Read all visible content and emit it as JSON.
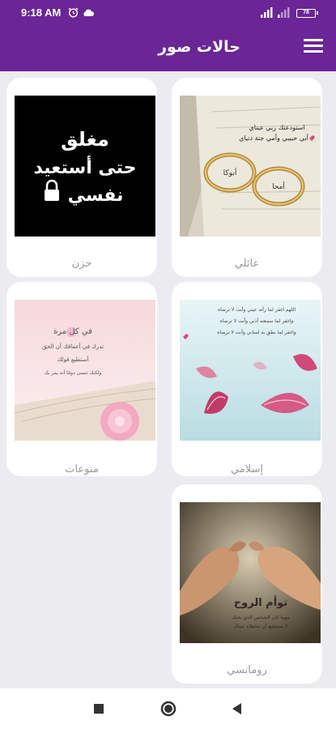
{
  "status_bar": {
    "time": "9:18 AM",
    "battery": "78",
    "icons": [
      "alarm-icon",
      "cloud-icon",
      "signal-icon",
      "signal-weak-icon",
      "battery-icon"
    ]
  },
  "app_bar": {
    "title": "حالات صور",
    "menu_icon": "hamburger-menu-icon",
    "color": "#6a2596"
  },
  "categories": [
    {
      "label": "عائلي",
      "image_text": [
        "استودعتك ربي عيناي",
        "أبي حبيبي وأمي جنة دنياي",
        "أبوكا",
        "أمحا"
      ]
    },
    {
      "label": "حزن",
      "image_text": [
        "مغلق",
        "حتى أستعيد",
        "نفسي"
      ]
    },
    {
      "label": "إسلامي",
      "image_text": [
        "اللهم اغفر لما رأته عيني وأنت لا ترضاه",
        "واغفر لما سمعته أذني وأنت لا ترضاه",
        "واغفر لما نطق به لساني وأنت لا ترضاه"
      ]
    },
    {
      "label": "منوعات",
      "image_text": [
        "في كل مرة",
        "تدرك في أعماقك أن الحق",
        "أستطيع قولك",
        "ولكنك تنسى دومًا أنه يمر بك"
      ]
    },
    {
      "label": "رومانسي",
      "image_text": [
        "توأم الروح",
        "مهما كان الشخص الذي يحبك",
        "لا تستطيع أن تتخطاه عيناك"
      ]
    }
  ],
  "nav_bar": {
    "icons": [
      "recent-apps-icon",
      "home-icon",
      "back-icon"
    ]
  }
}
